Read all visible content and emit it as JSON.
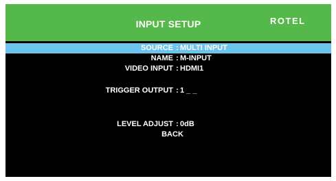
{
  "header": {
    "title": "INPUT SETUP",
    "brand": "ROTEL",
    "colors": {
      "header_bg": "#55b84a",
      "selected_bg": "#6cc4ec"
    }
  },
  "menu": {
    "separator": ":",
    "items": [
      {
        "label": "SOURCE",
        "value": "MULTI INPUT",
        "selected": true
      },
      {
        "label": "NAME",
        "value": "M-INPUT",
        "selected": false
      },
      {
        "label": "VIDEO INPUT",
        "value": "HDMI1",
        "selected": false
      },
      {
        "label": "TRIGGER OUTPUT",
        "value": "1 _ _",
        "selected": false
      },
      {
        "label": "LEVEL ADJUST",
        "value": "0dB",
        "selected": false
      }
    ],
    "back_label": "BACK"
  }
}
